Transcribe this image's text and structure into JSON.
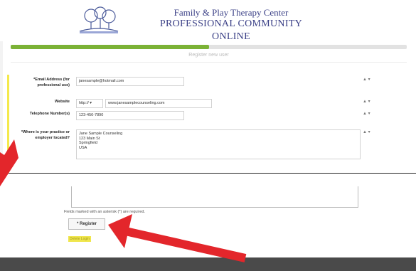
{
  "header": {
    "org_line1": "Family & Play Therapy Center",
    "org_line2": "PROFESSIONAL COMMUNITY ONLINE",
    "logo_icon": "family-tree-logo-icon"
  },
  "progress": {
    "fraction": 0.5,
    "label": "Register new user"
  },
  "form": {
    "fields": [
      {
        "label": "*Email Address (for professional use)",
        "value": "janesample@hotmail.com",
        "visibility": "▲ ▾"
      },
      {
        "label": "Website",
        "protocol": "http:// ▾",
        "value": "www.janesamplecounseling.com",
        "visibility": "▲ ▾"
      },
      {
        "label": "Telephone Number(s)",
        "value": "123-456-7890",
        "visibility": "▲ ▾"
      },
      {
        "label": "*Where is your practice or employer located?",
        "address_lines": [
          "Jane Sample Counseling",
          "123 Main St",
          "Springfield",
          "USA"
        ],
        "visibility": "▲ ▾"
      }
    ],
    "required_note": "Fields marked with an asterisk (*) are required.",
    "register_label": "* Register",
    "yellow_label": "Delete Login"
  },
  "colors": {
    "brand": "#3a3f86",
    "progress": "#7bb236",
    "highlight": "#f4e94b",
    "annotation_arrow": "#e3262b",
    "footer": "#4a4a4a"
  }
}
